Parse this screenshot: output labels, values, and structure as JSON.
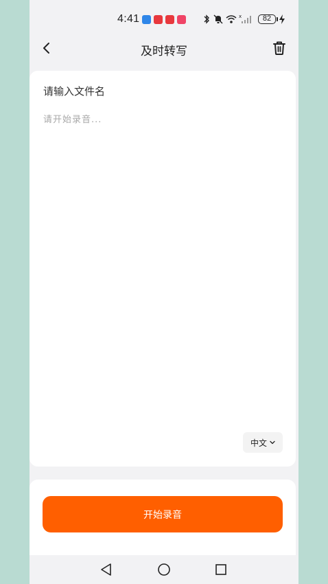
{
  "status_bar": {
    "time": "4:41",
    "battery": "82",
    "app_icons": [
      {
        "name": "blue-app-icon",
        "color": "#2f86e8"
      },
      {
        "name": "red-app-icon",
        "color": "#e8383d"
      },
      {
        "name": "red-app-icon-2",
        "color": "#e8383d"
      },
      {
        "name": "pink-app-icon",
        "color": "#f04466"
      }
    ],
    "system_icons": [
      "bluetooth-icon",
      "mute-icon",
      "wifi-icon",
      "signal-icon",
      "battery-icon",
      "charging-icon"
    ]
  },
  "header": {
    "title": "及时转写",
    "back_icon": "back-arrow-icon",
    "delete_icon": "trash-icon"
  },
  "editor": {
    "filename_placeholder": "请输入文件名",
    "transcript_placeholder": "请开始录音...",
    "language": "中文"
  },
  "record": {
    "button_label": "开始录音",
    "accent_color": "#ff5f00"
  },
  "system_nav": [
    "back-triangle-icon",
    "home-circle-icon",
    "recents-square-icon"
  ]
}
